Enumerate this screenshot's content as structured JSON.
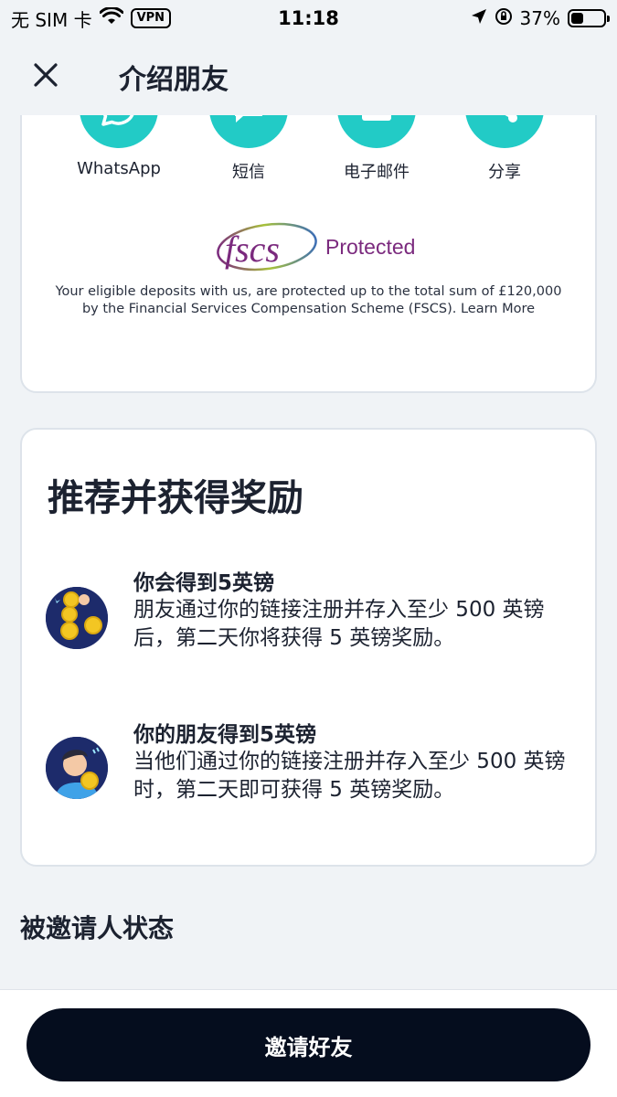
{
  "status_bar": {
    "carrier": "无 SIM 卡",
    "vpn": "VPN",
    "time": "11:18",
    "battery": "37%",
    "battery_level": 0.37
  },
  "header": {
    "title": "介绍朋友",
    "close_icon": "close-icon"
  },
  "share": {
    "items": [
      {
        "label": "WhatsApp",
        "icon": "whatsapp-icon"
      },
      {
        "label": "短信",
        "icon": "sms-icon"
      },
      {
        "label": "电子邮件",
        "icon": "email-icon"
      },
      {
        "label": "分享",
        "icon": "share-icon"
      }
    ],
    "accent_color": "#22cbc6"
  },
  "fscs": {
    "logo_text": "fscs",
    "protected": "Protected",
    "disclaimer": "Your eligible deposits with us, are protected up to the total sum of £120,000 by the Financial Services Compensation Scheme (FSCS). Learn More"
  },
  "referral": {
    "title": "推荐并获得奖励",
    "rewards": [
      {
        "title": "你会得到5英镑",
        "description": "朋友通过你的链接注册并存入至少 500 英镑后，第二天你将获得 5 英镑奖励。",
        "icon": "coins-icon"
      },
      {
        "title": "你的朋友得到5英镑",
        "description": "当他们通过你的链接注册并存入至少 500 英镑时，第二天即可获得 5 英镑奖励。",
        "icon": "friend-avatar-icon"
      }
    ]
  },
  "invitee_status": {
    "title": "被邀请人状态"
  },
  "bottom": {
    "invite_label": "邀请好友",
    "button_color": "#050d1e"
  }
}
